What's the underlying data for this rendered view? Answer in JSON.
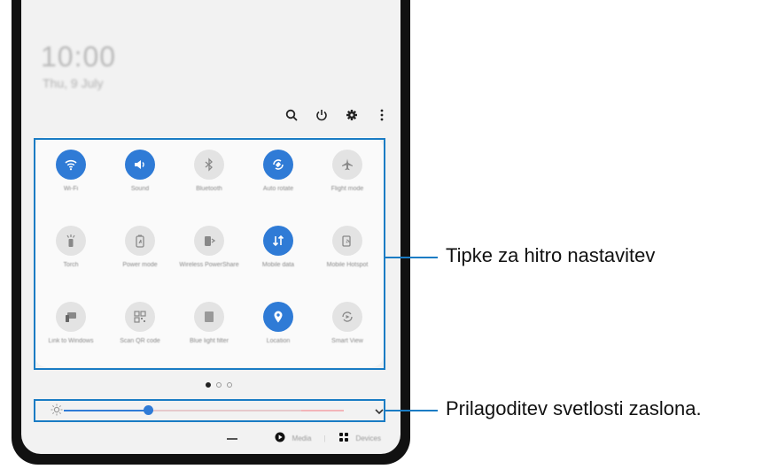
{
  "status": {
    "time": "10:00",
    "date": "Thu, 9 July"
  },
  "toolbar": [
    "search-icon",
    "power-icon",
    "settings-icon",
    "more-options-icon"
  ],
  "tiles": [
    {
      "label": "Wi-Fi",
      "icon": "wifi-icon",
      "on": true
    },
    {
      "label": "Sound",
      "icon": "sound-icon",
      "on": true
    },
    {
      "label": "Bluetooth",
      "icon": "bluetooth-icon",
      "on": false
    },
    {
      "label": "Auto rotate",
      "icon": "auto-rotate-icon",
      "on": true
    },
    {
      "label": "Flight mode",
      "icon": "airplane-icon",
      "on": false
    },
    {
      "label": "Torch",
      "icon": "torch-icon",
      "on": false
    },
    {
      "label": "Power mode",
      "icon": "power-mode-icon",
      "on": false
    },
    {
      "label": "Wireless PowerShare",
      "icon": "powershare-icon",
      "on": false
    },
    {
      "label": "Mobile data",
      "icon": "mobile-data-icon",
      "on": true
    },
    {
      "label": "Mobile Hotspot",
      "icon": "hotspot-icon",
      "on": false
    },
    {
      "label": "Link to Windows",
      "icon": "link-to-windows-icon",
      "on": false
    },
    {
      "label": "Scan QR code",
      "icon": "qr-code-icon",
      "on": false
    },
    {
      "label": "Blue light filter",
      "icon": "blue-light-filter-icon",
      "on": false
    },
    {
      "label": "Location",
      "icon": "location-icon",
      "on": true
    },
    {
      "label": "Smart View",
      "icon": "smart-view-icon",
      "on": false
    }
  ],
  "pages": {
    "count": 3,
    "active": 0
  },
  "brightness": {
    "level": 0.3,
    "icon": "brightness-icon"
  },
  "bottom": {
    "media": "Media",
    "devices": "Devices"
  },
  "callouts": {
    "quick_settings": "Tipke za hitro nastavitev",
    "brightness": "Prilagoditev svetlosti zaslona."
  },
  "colors": {
    "accent": "#2f7bd6",
    "callout_line": "#1a7cc4"
  }
}
